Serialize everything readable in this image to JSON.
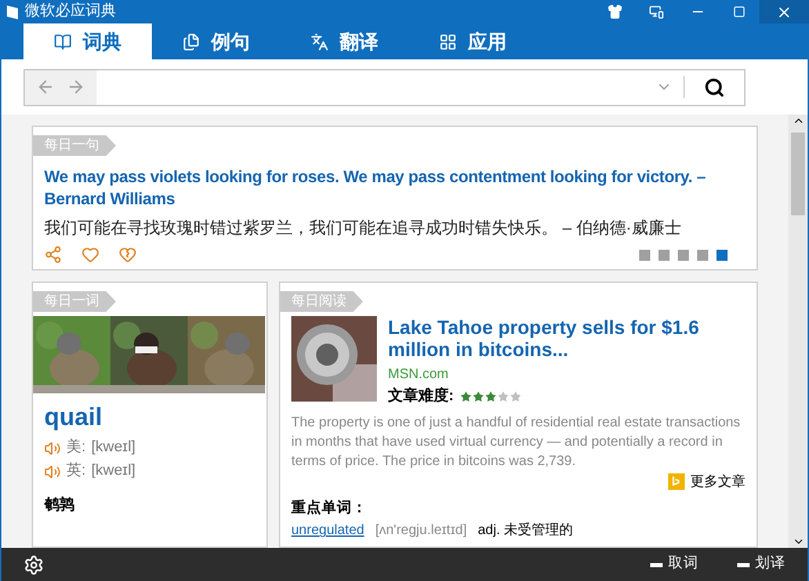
{
  "window": {
    "title": "微软必应词典"
  },
  "tabs": [
    {
      "label": "词典",
      "selected": true,
      "kind": "dict"
    },
    {
      "label": "例句",
      "selected": false,
      "kind": "examples"
    },
    {
      "label": "翻译",
      "selected": false,
      "kind": "translate"
    },
    {
      "label": "应用",
      "selected": false,
      "kind": "apps"
    }
  ],
  "daily_sentence": {
    "tag": "每日一句",
    "english": "We may pass violets looking for roses. We may pass contentment looking for victory. – Bernard Williams",
    "chinese": "我们可能在寻找玫瑰时错过紫罗兰，我们可能在追寻成功时错失快乐。 – 伯纳德·威廉士",
    "dots": [
      {
        "selected": false
      },
      {
        "selected": false
      },
      {
        "selected": false
      },
      {
        "selected": false
      },
      {
        "selected": true
      }
    ]
  },
  "daily_word": {
    "tag": "每日一词",
    "word": "quail",
    "pronunciations": [
      {
        "label": "美:",
        "phonetic": "[kweɪl]"
      },
      {
        "label": "英:",
        "phonetic": "[kweɪl]"
      }
    ],
    "meaning": "鹌鹑"
  },
  "daily_reading": {
    "tag": "每日阅读",
    "title": "Lake Tahoe property sells for $1.6 million in bitcoins...",
    "source": "MSN.com",
    "difficulty_label": "文章难度:",
    "stars": 3,
    "summary": "The property is one of just a handful of residential real estate transactions in months that have used virtual currency — and potentially a record in terms of price. The price in bitcoins was 2,739.",
    "more_link": "更多文章",
    "key_words_label": "重点单词：",
    "key_words": [
      {
        "word": "unregulated",
        "phonetic": "[ʌn'regju.leɪtɪd]",
        "meaning": "adj. 未受管理的"
      }
    ]
  },
  "bottom_bar": {
    "toggles": [
      {
        "label": "取词"
      },
      {
        "label": "划译"
      }
    ]
  }
}
